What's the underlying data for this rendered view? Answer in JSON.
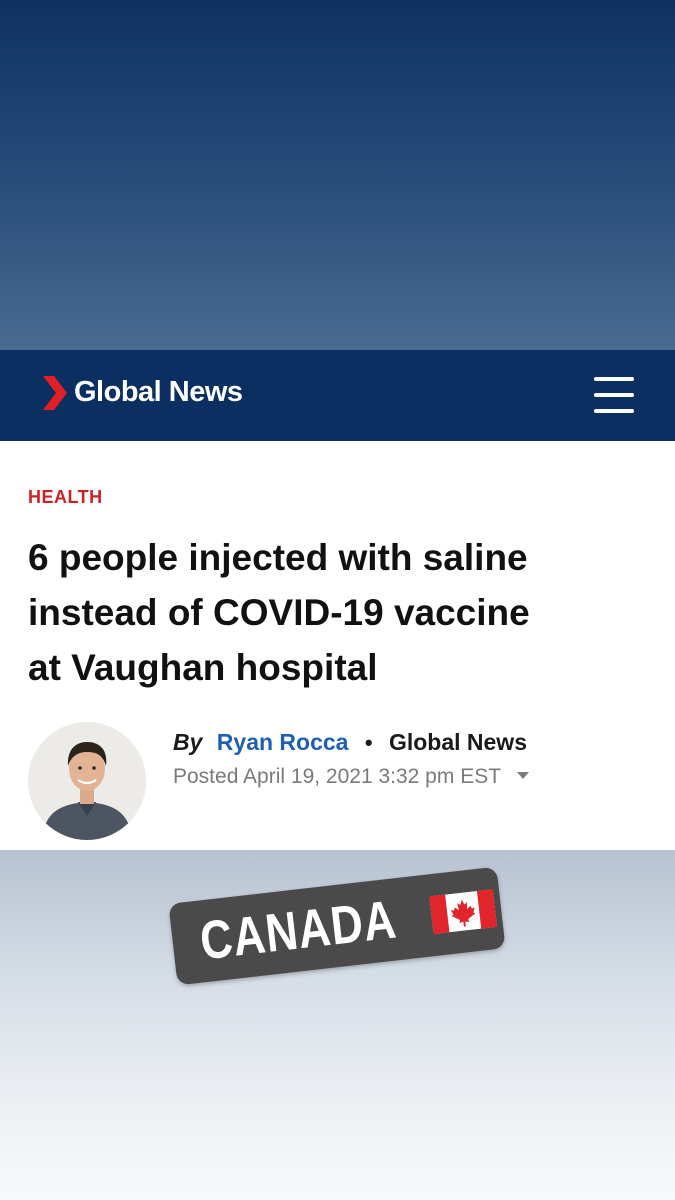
{
  "header": {
    "logo_text": "Global News",
    "logo_icon": "global-news-chevron-logo",
    "menu_icon": "hamburger-menu-icon"
  },
  "article": {
    "category": "HEALTH",
    "headline_lines": [
      "6 people injected with saline",
      "instead of COVID-19 vaccine",
      "at Vaughan hospital"
    ],
    "byline": {
      "by_label": "By",
      "author": "Ryan Rocca",
      "separator": "•",
      "outlet": "Global News"
    },
    "posted": "Posted April 19, 2021 3:32 pm EST"
  },
  "sticker": {
    "text": "CANADA",
    "flag_icon": "canada-flag-emoji"
  },
  "colors": {
    "header_bg": "#0b2f61",
    "accent_red": "#cc2127",
    "author_blue": "#1f5fb3",
    "meta_gray": "#7a7a7a"
  }
}
